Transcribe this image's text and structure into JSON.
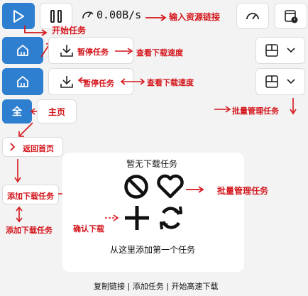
{
  "toolbar": {
    "speed": "0.00B/s"
  },
  "annotations": {
    "input_link": "输入资源链接",
    "start_task": "开始任务",
    "pause_task_1": "暂停任务",
    "view_speed_1": "查看下载速度",
    "pause_task_2": "暂停任务",
    "view_speed_2": "查看下载速度",
    "batch_manage_1": "批量管理任务",
    "home_label": "主页",
    "back_home": "返回首页",
    "add_task_1": "添加下载任务",
    "add_task_2": "添加下载任务",
    "confirm_download": "确认下载",
    "batch_manage_2": "批量管理任务"
  },
  "sidebar": {
    "all_glyph": "全"
  },
  "empty_state": {
    "title": "暂无下载任务",
    "subtitle": "从这里添加第一个任务"
  },
  "footer": {
    "text": "复制链接 | 添加任务 | 开始高速下载"
  },
  "colors": {
    "accent": "#2f7fd0",
    "annotation": "#d4161c",
    "background": "#f3f3f3"
  }
}
